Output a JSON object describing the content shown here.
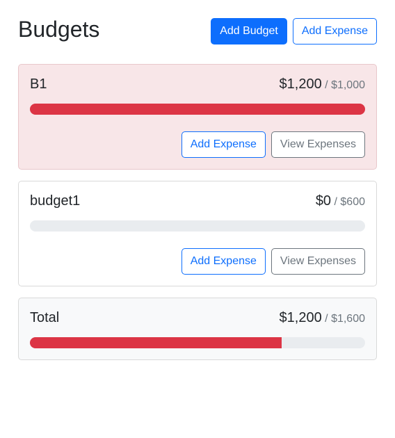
{
  "header": {
    "title": "Budgets",
    "add_budget_label": "Add Budget",
    "add_expense_label": "Add Expense"
  },
  "budgets": [
    {
      "name": "B1",
      "spent": "$1,200",
      "max": "/ $1,000",
      "progress_fraction": 1.0,
      "add_expense_label": "Add Expense",
      "view_expenses_label": "View Expenses"
    },
    {
      "name": "budget1",
      "spent": "$0",
      "max": "/ $600",
      "progress_fraction": 0.0,
      "add_expense_label": "Add Expense",
      "view_expenses_label": "View Expenses"
    }
  ],
  "total": {
    "name": "Total",
    "spent": "$1,200",
    "max": "/ $1,600",
    "progress_fraction": 0.75
  },
  "colors": {
    "primary": "#0d6efd",
    "danger": "#dc3545",
    "over_budget_background": "#f8e6e8",
    "total_background": "#f8f9fa",
    "progress_track": "#e9ecef"
  }
}
